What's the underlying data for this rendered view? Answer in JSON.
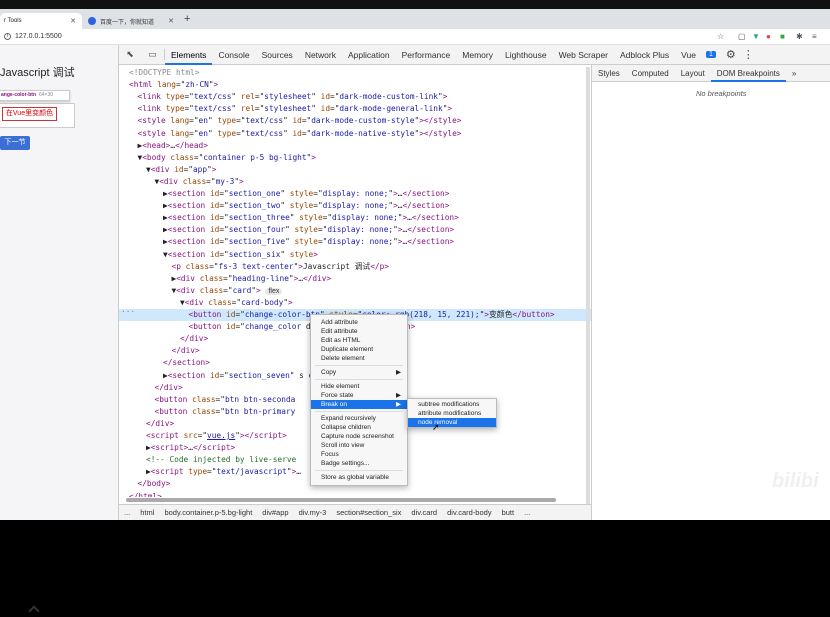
{
  "browser": {
    "tabs": [
      {
        "title": "r Tools",
        "active": true
      },
      {
        "title": "百度一下，你就知道",
        "active": false
      }
    ],
    "url": "127.0.0.1:5500"
  },
  "page": {
    "title": "Javascript 调试",
    "tooltip_name": "ange-color-btn",
    "tooltip_size": "64×30",
    "change_button": "在Vue里变颜色",
    "next_button": "下一节"
  },
  "devtools": {
    "tabs": [
      "Elements",
      "Console",
      "Sources",
      "Network",
      "Application",
      "Performance",
      "Memory",
      "Lighthouse",
      "Web Scraper",
      "Adblock Plus",
      "Vue"
    ],
    "active_tab": "Elements",
    "badge": "1"
  },
  "elements": {
    "lines": [
      {
        "indent": 0,
        "html": "<span class='gray'>&lt;!DOCTYPE html&gt;</span>"
      },
      {
        "indent": 0,
        "html": "<span class='tag'>&lt;html</span> <span class='attr'>lang</span>=\"<span class='val'>zh-CN</span>\"<span class='tag'>&gt;</span>"
      },
      {
        "indent": 1,
        "html": "<span class='tag'>&lt;link</span> <span class='attr'>type</span>=\"<span class='val'>text/css</span>\" <span class='attr'>rel</span>=\"<span class='val'>stylesheet</span>\" <span class='attr'>id</span>=\"<span class='val'>dark-mode-custom-link</span>\"<span class='tag'>&gt;</span>"
      },
      {
        "indent": 1,
        "html": "<span class='tag'>&lt;link</span> <span class='attr'>type</span>=\"<span class='val'>text/css</span>\" <span class='attr'>rel</span>=\"<span class='val'>stylesheet</span>\" <span class='attr'>id</span>=\"<span class='val'>dark-mode-general-link</span>\"<span class='tag'>&gt;</span>"
      },
      {
        "indent": 1,
        "html": "<span class='tag'>&lt;style</span> <span class='attr'>lang</span>=\"<span class='val'>en</span>\" <span class='attr'>type</span>=\"<span class='val'>text/css</span>\" <span class='attr'>id</span>=\"<span class='val'>dark-mode-custom-style</span>\"<span class='tag'>&gt;&lt;/style&gt;</span>"
      },
      {
        "indent": 1,
        "html": "<span class='tag'>&lt;style</span> <span class='attr'>lang</span>=\"<span class='val'>en</span>\" <span class='attr'>type</span>=\"<span class='val'>text/css</span>\" <span class='attr'>id</span>=\"<span class='val'>dark-mode-native-style</span>\"<span class='tag'>&gt;&lt;/style&gt;</span>"
      },
      {
        "indent": 1,
        "html": "▶<span class='tag'>&lt;head&gt;</span>…<span class='tag'>&lt;/head&gt;</span>"
      },
      {
        "indent": 1,
        "html": "▼<span class='tag'>&lt;body</span> <span class='attr'>class</span>=\"<span class='val'>container p-5 bg-light</span>\"<span class='tag'>&gt;</span>"
      },
      {
        "indent": 2,
        "html": "▼<span class='tag'>&lt;div</span> <span class='attr'>id</span>=\"<span class='val'>app</span>\"<span class='tag'>&gt;</span>"
      },
      {
        "indent": 3,
        "html": "▼<span class='tag'>&lt;div</span> <span class='attr'>class</span>=\"<span class='val'>my-3</span>\"<span class='tag'>&gt;</span>"
      },
      {
        "indent": 4,
        "html": "▶<span class='tag'>&lt;section</span> <span class='attr'>id</span>=\"<span class='val'>section_one</span>\" <span class='attr'>style</span>=\"<span class='val'>display: none;</span>\"<span class='tag'>&gt;</span>…<span class='tag'>&lt;/section&gt;</span>"
      },
      {
        "indent": 4,
        "html": "▶<span class='tag'>&lt;section</span> <span class='attr'>id</span>=\"<span class='val'>section_two</span>\" <span class='attr'>style</span>=\"<span class='val'>display: none;</span>\"<span class='tag'>&gt;</span>…<span class='tag'>&lt;/section&gt;</span>"
      },
      {
        "indent": 4,
        "html": "▶<span class='tag'>&lt;section</span> <span class='attr'>id</span>=\"<span class='val'>section_three</span>\" <span class='attr'>style</span>=\"<span class='val'>display: none;</span>\"<span class='tag'>&gt;</span>…<span class='tag'>&lt;/section&gt;</span>"
      },
      {
        "indent": 4,
        "html": "▶<span class='tag'>&lt;section</span> <span class='attr'>id</span>=\"<span class='val'>section_four</span>\" <span class='attr'>style</span>=\"<span class='val'>display: none;</span>\"<span class='tag'>&gt;</span>…<span class='tag'>&lt;/section&gt;</span>"
      },
      {
        "indent": 4,
        "html": "▶<span class='tag'>&lt;section</span> <span class='attr'>id</span>=\"<span class='val'>section_five</span>\" <span class='attr'>style</span>=\"<span class='val'>display: none;</span>\"<span class='tag'>&gt;</span>…<span class='tag'>&lt;/section&gt;</span>"
      },
      {
        "indent": 4,
        "html": "▼<span class='tag'>&lt;section</span> <span class='attr'>id</span>=\"<span class='val'>section_six</span>\" <span class='attr'>style</span><span class='tag'>&gt;</span>"
      },
      {
        "indent": 5,
        "html": "<span class='tag'>&lt;p</span> <span class='attr'>class</span>=\"<span class='val'>fs-3 text-center</span>\"<span class='tag'>&gt;</span>Javascript 调试<span class='tag'>&lt;/p&gt;</span>"
      },
      {
        "indent": 5,
        "html": "▶<span class='tag'>&lt;div</span> <span class='attr'>class</span>=\"<span class='val'>heading-line</span>\"<span class='tag'>&gt;</span>…<span class='tag'>&lt;/div&gt;</span>"
      },
      {
        "indent": 5,
        "html": "▼<span class='tag'>&lt;div</span> <span class='attr'>class</span>=\"<span class='val'>card</span>\"<span class='tag'>&gt;</span> <span class='pill'>flex</span>"
      },
      {
        "indent": 6,
        "html": "▼<span class='tag'>&lt;div</span> <span class='attr'>class</span>=\"<span class='val'>card-body</span>\"<span class='tag'>&gt;</span>"
      },
      {
        "indent": 7,
        "sel": true,
        "html": "<span class='tag'>&lt;button</span> <span class='attr'>id</span>=\"<span class='val'>change-color-btn</span>\" <span class='attr'>style</span>=\"<span class='val'>color: rgb(218, 15, 221);</span>\"<span class='tag'>&gt;</span>变颜色<span class='tag'>&lt;/button&gt;</span>"
      },
      {
        "indent": 7,
        "html": "<span class='tag'>&lt;button</span> <span class='attr'>id</span>=\"<span class='val'>change_color</span>                   d\"<span class='tag'>&gt;</span>在Vue里变颜色<span class='tag'>&lt;/button&gt;</span>"
      },
      {
        "indent": 6,
        "html": "<span class='tag'>&lt;/div&gt;</span>"
      },
      {
        "indent": 5,
        "html": "<span class='tag'>&lt;/div&gt;</span>"
      },
      {
        "indent": 4,
        "html": "<span class='tag'>&lt;/section&gt;</span>"
      },
      {
        "indent": 4,
        "html": "▶<span class='tag'>&lt;section</span> <span class='attr'>id</span>=\"<span class='val'>section_seven</span>\" s                      <span class='val'>e;</span>\"<span class='tag'>&gt;</span>…<span class='tag'>&lt;/section&gt;</span>"
      },
      {
        "indent": 3,
        "html": "<span class='tag'>&lt;/div&gt;</span>"
      },
      {
        "indent": 3,
        "html": "<span class='tag'>&lt;button</span> <span class='attr'>class</span>=\"<span class='val'>btn btn-seconda</span>"
      },
      {
        "indent": 3,
        "html": "<span class='tag'>&lt;button</span> <span class='attr'>class</span>=\"<span class='val'>btn btn-primary</span>"
      },
      {
        "indent": 2,
        "html": "<span class='tag'>&lt;/div&gt;</span>"
      },
      {
        "indent": 2,
        "html": "<span class='tag'>&lt;script</span> <span class='attr'>src</span>=\"<span class='val' style='text-decoration:underline'>vue.js</span>\"<span class='tag'>&gt;&lt;/script&gt;</span>"
      },
      {
        "indent": 2,
        "html": "▶<span class='tag'>&lt;script&gt;</span>…<span class='tag'>&lt;/script&gt;</span>"
      },
      {
        "indent": 2,
        "html": "<span class='cm'>&lt;!-- Code injected by live-serve</span>"
      },
      {
        "indent": 2,
        "html": "▶<span class='tag'>&lt;script</span> <span class='attr'>type</span>=\"<span class='val'>text/javascript</span>\"<span class='tag'>&gt;</span>…"
      },
      {
        "indent": 1,
        "html": "<span class='tag'>&lt;/body&gt;</span>"
      },
      {
        "indent": 0,
        "html": "<span class='tag'>&lt;/html&gt;</span>"
      }
    ]
  },
  "breadcrumbs": [
    "...",
    "html",
    "body.container.p-5.bg-light",
    "div#app",
    "div.my-3",
    "section#section_six",
    "div.card",
    "div.card-body",
    "butt",
    "..."
  ],
  "sidebar": {
    "tabs": [
      "Styles",
      "Computed",
      "Layout",
      "DOM Breakpoints",
      "»"
    ],
    "active": "DOM Breakpoints",
    "empty_text": "No breakpoints"
  },
  "context_menu": [
    {
      "label": "Add attribute"
    },
    {
      "label": "Edit attribute"
    },
    {
      "label": "Edit as HTML"
    },
    {
      "label": "Duplicate element"
    },
    {
      "label": "Delete element"
    },
    {
      "sep": true
    },
    {
      "label": "Copy",
      "arrow": true
    },
    {
      "sep": true
    },
    {
      "label": "Hide element"
    },
    {
      "label": "Force state",
      "arrow": true
    },
    {
      "label": "Break on",
      "arrow": true,
      "highlight": true
    },
    {
      "sep": true
    },
    {
      "label": "Expand recursively"
    },
    {
      "label": "Collapse children"
    },
    {
      "label": "Capture node screenshot"
    },
    {
      "label": "Scroll into view"
    },
    {
      "label": "Focus"
    },
    {
      "label": "Badge settings..."
    },
    {
      "sep": true
    },
    {
      "label": "Store as global variable"
    }
  ],
  "submenu": [
    {
      "label": "subtree modifications"
    },
    {
      "label": "attribute modifications"
    },
    {
      "label": "node removal",
      "highlight": true
    }
  ],
  "watermark": "bilibi"
}
